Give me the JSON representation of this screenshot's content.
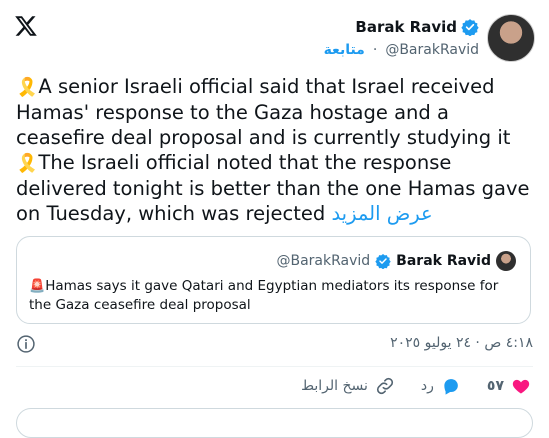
{
  "author": {
    "name": "Barak Ravid",
    "handle": "@BarakRavid",
    "follow_label": "متابعة"
  },
  "post": {
    "line1": "A senior Israeli official said that Israel received Hamas' response to the Gaza hostage and a ceasefire deal proposal and is currently studying it",
    "line2": "The Israeli official noted that the response delivered tonight is better than the one Hamas gave on Tuesday, which was rejected",
    "more_label": "عرض المزيد",
    "emoji": "🎗️"
  },
  "quote": {
    "name": "Barak Ravid",
    "handle": "@BarakRavid",
    "emoji": "🚨",
    "text": "Hamas says it gave Qatari and Egyptian mediators its response for the Gaza ceasefire deal proposal"
  },
  "meta": {
    "timestamp": "٤:١٨ ص · ٢٤ يوليو ٢٠٢٥"
  },
  "actions": {
    "likes": "٥٧",
    "reply_label": "رد",
    "copy_link_label": "نسخ الرابط"
  },
  "colors": {
    "accent": "#1d9bf0",
    "like": "#f91880",
    "text": "#0f1419",
    "secondary": "#536471"
  }
}
